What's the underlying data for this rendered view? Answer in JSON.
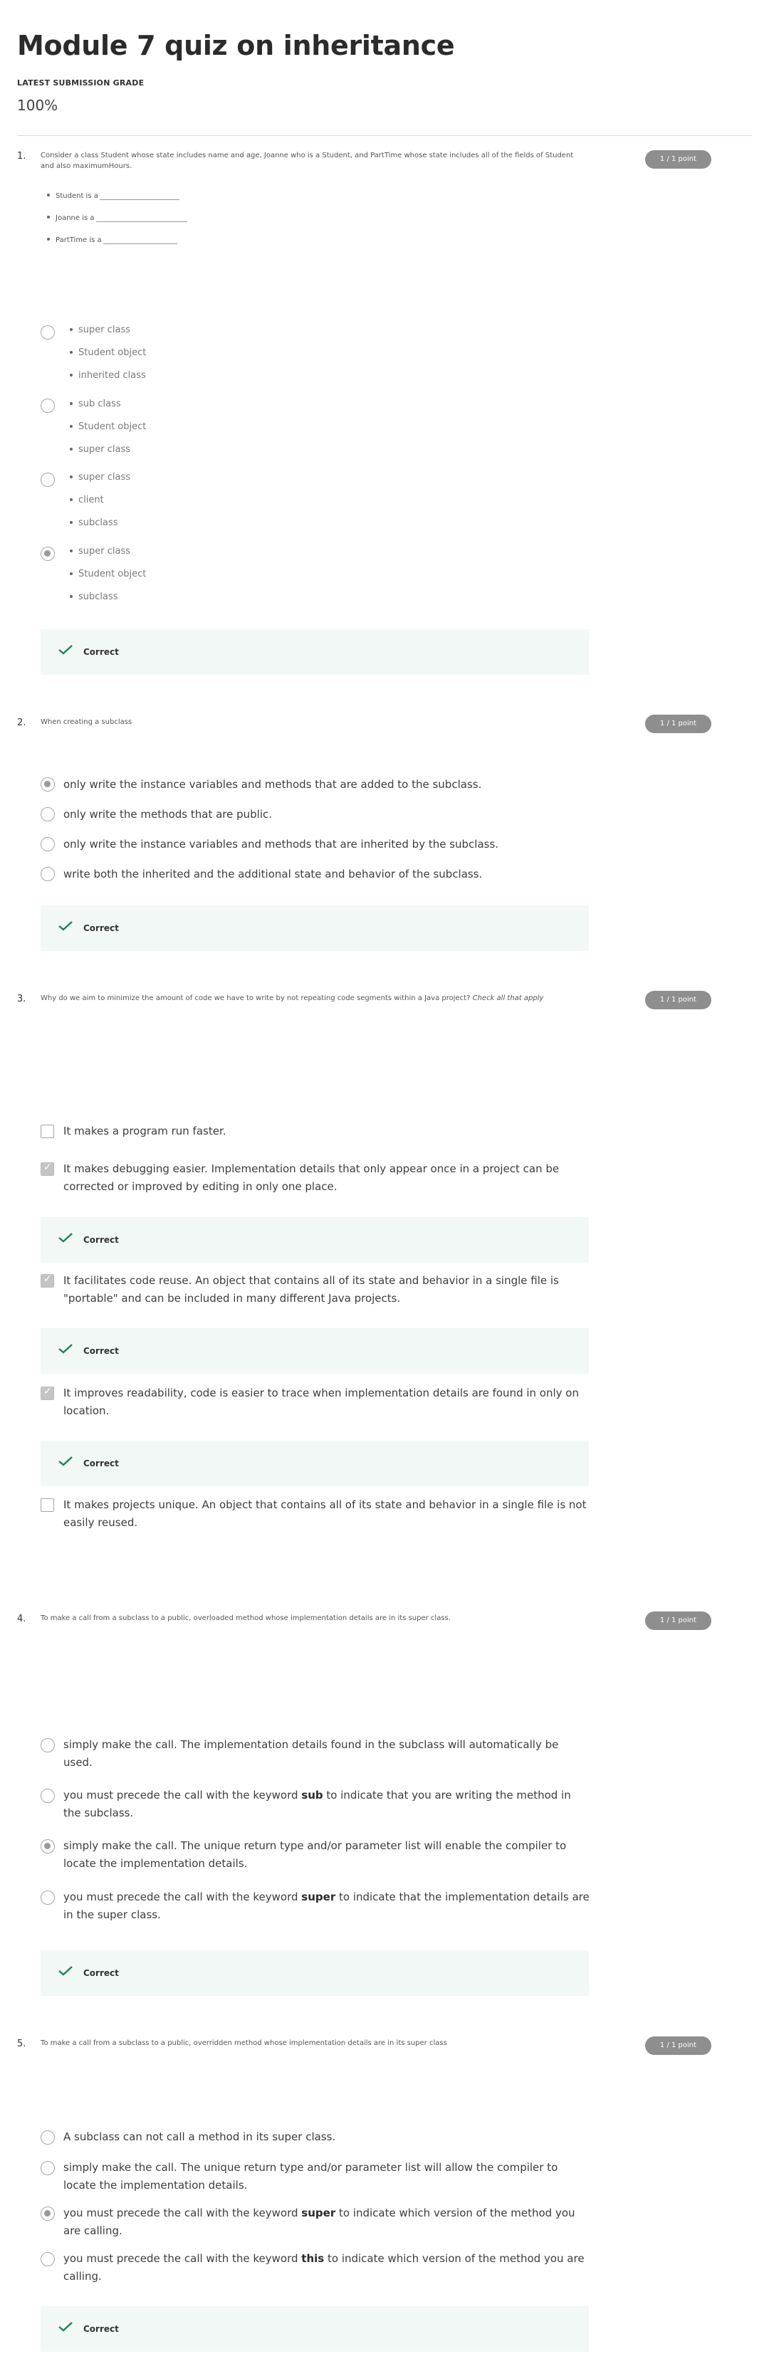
{
  "page": {
    "title": "Module 7 quiz on inheritance",
    "grade_label": "LATEST SUBMISSION GRADE",
    "grade_value": "100%"
  },
  "feedback_label": "Correct",
  "questions": [
    {
      "number": "1.",
      "points": "1 / 1 point",
      "text": "Consider a class Student whose state includes name and age, Joanne who is a Student, and PartTime whose state includes all of the fields of Student and also maximumHours.",
      "blanks": [
        "Student is a",
        "Joanne is a",
        "PartTime is a"
      ],
      "options": [
        {
          "selected": false,
          "items": [
            "super class",
            "Student object",
            "inherited class"
          ]
        },
        {
          "selected": false,
          "items": [
            "sub class",
            "Student object",
            "super class"
          ]
        },
        {
          "selected": false,
          "items": [
            "super class",
            "client",
            "subclass"
          ]
        },
        {
          "selected": true,
          "items": [
            "super class",
            "Student object",
            "subclass"
          ]
        }
      ]
    },
    {
      "number": "2.",
      "points": "1 / 1 point",
      "text": "When creating a subclass",
      "options": [
        {
          "selected": true,
          "text": "only write the instance variables and methods that are added to the subclass."
        },
        {
          "selected": false,
          "text": "only write the methods that are public."
        },
        {
          "selected": false,
          "text": "only write the instance variables and methods that are inherited by the subclass."
        },
        {
          "selected": false,
          "text": "write both the inherited and the additional state and behavior of the subclass."
        }
      ]
    },
    {
      "number": "3.",
      "points": "1 / 1 point",
      "text": "Why do we aim to minimize the amount of code we have to write by not repeating code segments within a Java project?",
      "text_emphasis": "Check all that apply",
      "options": [
        {
          "checked": false,
          "text": "It makes a program run faster."
        },
        {
          "checked": true,
          "text": "It makes debugging easier. Implementation details that only appear once in a project can be corrected or improved by editing in only one place."
        },
        {
          "checked": true,
          "text": "It facilitates code reuse. An object that contains all of its state and behavior in a single file is \"portable\" and can be included in many different Java projects."
        },
        {
          "checked": true,
          "text": "It improves readability, code is easier to trace when implementation details are found in only on location."
        },
        {
          "checked": false,
          "text": "It makes projects unique. An object that contains all of its state and behavior in a single file is not easily reused."
        }
      ]
    },
    {
      "number": "4.",
      "points": "1 / 1 point",
      "text": "To make a call from a subclass to a public, overloaded method whose implementation details are in its super class.",
      "options": [
        {
          "selected": false,
          "before": "simply make the call. The implementation details found in the subclass will automatically be used.",
          "keyword": "",
          "after": ""
        },
        {
          "selected": false,
          "before": "you must precede the call with the keyword ",
          "keyword": "sub",
          "after": " to indicate that you are writing the method in the subclass."
        },
        {
          "selected": true,
          "before": "simply make the call. The unique return type and/or parameter list will enable the compiler to locate the implementation details.",
          "keyword": "",
          "after": ""
        },
        {
          "selected": false,
          "before": "you must precede the call with the keyword ",
          "keyword": "super",
          "after": " to indicate that the implementation details are in the super class."
        }
      ]
    },
    {
      "number": "5.",
      "points": "1 / 1 point",
      "text": "To make a call from a subclass to a public, overridden method whose implementation details are in its super class",
      "options": [
        {
          "selected": false,
          "before": "A subclass can not call a method in its super class.",
          "keyword": "",
          "after": ""
        },
        {
          "selected": false,
          "before": "simply make the call. The unique return type and/or parameter list will allow the compiler to locate the implementation details.",
          "keyword": "",
          "after": ""
        },
        {
          "selected": true,
          "before": "you must precede the call with the keyword ",
          "keyword": "super",
          "after": " to indicate which version of the method you are calling."
        },
        {
          "selected": false,
          "before": "you must precede the call with the keyword ",
          "keyword": "this",
          "after": " to indicate which version of the method you are calling."
        }
      ]
    }
  ]
}
